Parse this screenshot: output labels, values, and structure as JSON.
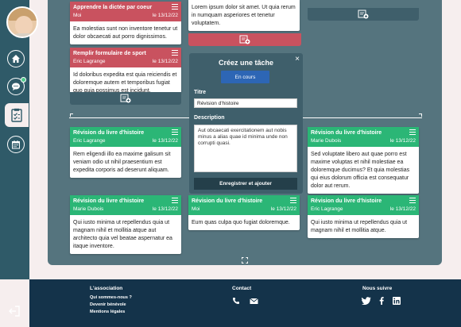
{
  "sidebar": {
    "items": [
      {
        "name": "home-icon"
      },
      {
        "name": "chat-icon"
      },
      {
        "name": "clipboard-icon"
      },
      {
        "name": "calendar-icon"
      }
    ],
    "logout_icon": "logout-icon"
  },
  "board": {
    "left_column": {
      "cards": [
        {
          "title": "Apprendre la dictée par coeur",
          "author": "Moi",
          "date": "le 13/12/22",
          "color": "#c9525f",
          "text": "Ea molestias sunt non inventore tenetur ut dolor obcaecati aut porro dignissimos."
        },
        {
          "title": "Remplir formulaire de sport",
          "author": "Eric Lagrange",
          "date": "le 13/12/22",
          "color": "#c9525f",
          "text": "Id doloribus expedita est quia reiciendis et doloremque autem et temporibus fugiat quo quia possimus est incidunt."
        },
        {
          "title": "Révision du livre d'histoire",
          "author": "Eric Lagrange",
          "date": "le 13/12/22",
          "color": "#2bb676",
          "text": "Rem eligendi illo ea maxime galisum sit veniam odio ut nihil praesentium est expedita corporis ad deserunt aliquam."
        },
        {
          "title": "Révision du livre d'histoire",
          "author": "Marie Dubois",
          "date": "le 13/12/22",
          "color": "#2bb676",
          "text": "Qui iusto minima ut repellendus quia ut magnam nihil et mollitia atque aut architecto quia vel beatae aspernatur ea itaque inventore."
        }
      ]
    },
    "middle_column": {
      "cards": [
        {
          "title": "",
          "author": "",
          "date": "",
          "text": "Lorem ipsum dolor sit amet. Ut quia rerum in numquam asperiores et tenetur voluptatem."
        },
        {
          "title": "Révision du livre d'histoire",
          "author": "Moi",
          "date": "le 13/12/22",
          "color": "#2bb676",
          "text": "Eum quas culpa quo fugiat doloremque."
        }
      ]
    },
    "right_column": {
      "cards": [
        {
          "title": "Révision du livre d'histoire",
          "author": "Marie Dubois",
          "date": "le 13/12/22",
          "color": "#2bb676",
          "text": "Sed voluptate libero aut quae porro est maxime voluptas et nihil molestiae ea doloremque ducimus? Et quia molestias qui eius dolorum officia est consequatur dolor aut rerum."
        },
        {
          "title": "Révision du livre d'histoire",
          "author": "Eric Lagrange",
          "date": "le 13/12/22",
          "color": "#2bb676",
          "text": "Qui iusto minima ut repellendus quia ut magnam nihil et mollitia atque."
        }
      ]
    }
  },
  "modal": {
    "title": "Créez une tâche",
    "close": "×",
    "status": "En cours",
    "title_label": "Titre",
    "title_value": "Révision d'histoire",
    "description_label": "Description",
    "description_value": "Aut obcaecati exercitationem aut nobis minus a alias quae id minima unde non corrupti quasi.",
    "submit": "Enregistrer et ajouter"
  },
  "footer": {
    "association_heading": "L'association",
    "links": [
      "Qui sommes-nous ?",
      "Devenir bénévole",
      "Mentions légales"
    ],
    "contact_heading": "Contact",
    "follow_heading": "Nous suivre"
  }
}
